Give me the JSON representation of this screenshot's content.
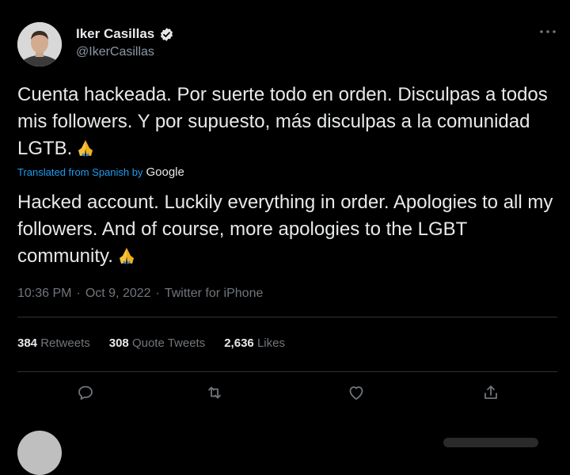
{
  "author": {
    "display_name": "Iker Casillas",
    "handle": "@IkerCasillas",
    "verified_icon": "verified-badge-icon"
  },
  "tweet": {
    "original_text": "Cuenta hackeada. Por suerte todo en orden. Disculpas a todos mis followers. Y por supuesto, más disculpas a la comunidad LGTB.",
    "translated_from": "Translated from Spanish by",
    "translator": "Google",
    "translated_text": "Hacked account. Luckily everything in order. Apologies to all my followers. And of course, more apologies to the LGBT community.",
    "emoji": "folded-hands-icon",
    "time": "10:36 PM",
    "separator": "·",
    "date": "Oct 9, 2022",
    "source": "Twitter for iPhone"
  },
  "stats": {
    "retweets_count": "384",
    "retweets_label": "Retweets",
    "quotes_count": "308",
    "quotes_label": "Quote Tweets",
    "likes_count": "2,636",
    "likes_label": "Likes"
  },
  "actions": [
    "reply-icon",
    "retweet-icon",
    "like-icon",
    "share-icon"
  ],
  "colors": {
    "background": "#000000",
    "text": "#e7e9ea",
    "secondary": "#71767b",
    "link": "#1d9bf0",
    "divider": "#2f3336"
  }
}
